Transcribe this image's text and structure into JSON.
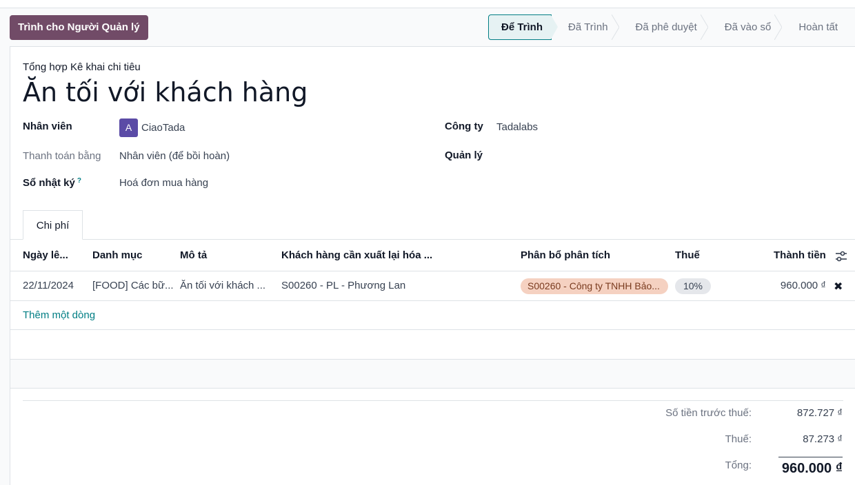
{
  "header": {
    "submit_button": "Trình cho Người Quản lý",
    "stages": [
      "Để Trình",
      "Đã Trình",
      "Đã phê duyệt",
      "Đã vào sổ",
      "Hoàn tất"
    ],
    "current_stage": "Để Trình"
  },
  "form": {
    "subtitle": "Tổng hợp Kê khai chi tiêu",
    "title": "Ăn tối với khách hàng",
    "employee_label": "Nhân viên",
    "employee_avatar": "A",
    "employee_value": "CiaoTada",
    "paid_by_label": "Thanh toán bằng",
    "paid_by_value": "Nhân viên (để bồi hoàn)",
    "journal_label": "Sổ nhật ký",
    "journal_help": "?",
    "journal_value": "Hoá đơn mua hàng",
    "company_label": "Công ty",
    "company_value": "Tadalabs",
    "manager_label": "Quản lý",
    "manager_value": ""
  },
  "tabs": [
    "Chi phí"
  ],
  "table": {
    "columns": [
      "Ngày lê...",
      "Danh mục",
      "Mô tả",
      "Khách hàng cần xuất lại hóa ...",
      "Phân bổ phân tích",
      "Thuế",
      "Thành tiền"
    ],
    "rows": [
      {
        "date": "22/11/2024",
        "category": "[FOOD] Các bữ...",
        "description": "Ăn tối với khách ...",
        "customer": "S00260 - PL - Phương Lan",
        "analytic": "S00260 - Công ty TNHH Bảo...",
        "tax": "10%",
        "amount": "960.000 ₫"
      }
    ],
    "add_line": "Thêm một dòng"
  },
  "totals": {
    "untaxed_label": "Số tiền trước thuế:",
    "untaxed_value": "872.727 ₫",
    "tax_label": "Thuế:",
    "tax_value": "87.273 ₫",
    "total_label": "Tổng:",
    "total_value": "960.000 ₫"
  },
  "icons": {
    "column_settings": "sliders-icon",
    "delete": "close-icon"
  },
  "colors": {
    "primary": "#714b67",
    "accent": "#017e84",
    "analytic_tag": "#f5d1c1"
  }
}
